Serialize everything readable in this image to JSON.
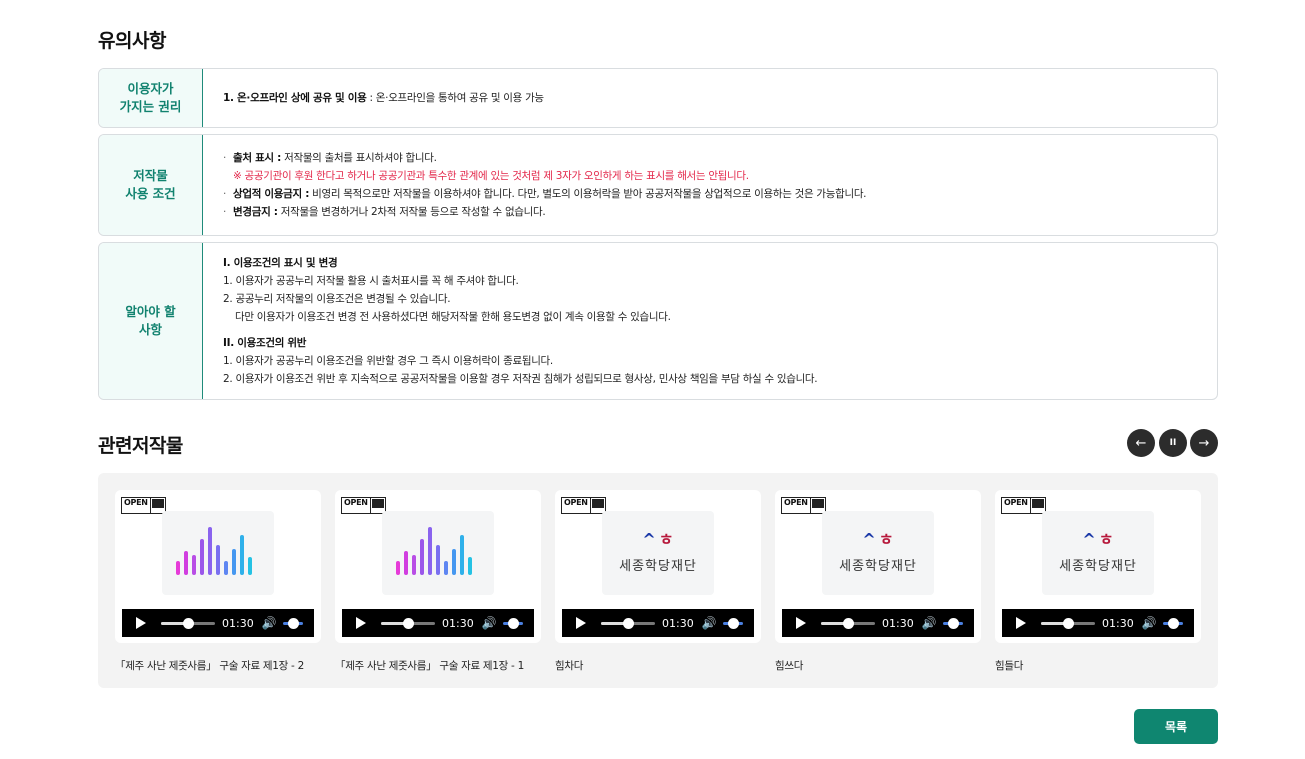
{
  "notice": {
    "title": "유의사항",
    "rights": {
      "label_1": "이용자가",
      "label_2": "가지는 권리",
      "text_bold": "1. 온·오프라인 상에 공유 및 이용",
      "text": " : 온·오프라인을 통하여 공유 및 이용 가능"
    },
    "conditions": {
      "label_1": "저작물",
      "label_2": "사용 조건",
      "items": [
        {
          "bold": "출처 표시 :",
          "text": " 저작물의 출처를 표시하셔야 합니다."
        },
        {
          "bold": "상업적 이용금지 :",
          "text": " 비영리 목적으로만 저작물을 이용하셔야 합니다. 다만, 별도의 이용허락을 받아 공공저작물을 상업적으로 이용하는 것은 가능합니다."
        },
        {
          "bold": "변경금지 :",
          "text": " 저작물을 변경하거나 2차적 저작물 등으로 작성할 수 없습니다."
        }
      ],
      "warning": "※ 공공기관이 후원 한다고 하거나 공공기관과 특수한 관계에 있는 것처럼 제 3자가 오인하게 하는 표시를 해서는 안됩니다."
    },
    "know": {
      "label_1": "알아야 할",
      "label_2": "사항",
      "section1_title": "I. 이용조건의 표시 및 변경",
      "section1_items": [
        "1. 이용자가 공공누리 저작물 활용 시 출처표시를 꼭 해 주셔야 합니다.",
        "2. 공공누리 저작물의 이용조건은 변경될 수 있습니다.",
        "다만 이용자가 이용조건 변경 전 사용하셨다면 해당저작물 한해 용도변경 없이 계속 이용할 수 있습니다."
      ],
      "section2_title": "II. 이용조건의 위반",
      "section2_items": [
        "1. 이용자가 공공누리 이용조건을 위반할 경우 그 즉시 이용허락이 종료됩니다.",
        "2. 이용자가 이용조건 위반 후 지속적으로 공공저작물을 이용할 경우 저작권 침해가 성립되므로 형사상, 민사상 책임을 부담 하실 수 있습니다."
      ]
    }
  },
  "related": {
    "title": "관련저작물",
    "controls": {
      "prev": "←",
      "pause": "II",
      "next": "→"
    },
    "items": [
      {
        "badge": "OPEN",
        "thumb": "equalizer",
        "time": "01:30",
        "progress": 0.5,
        "caption": "「제주 사난 제줏사름」 구술 자료 제1장 - 2"
      },
      {
        "badge": "OPEN",
        "thumb": "equalizer",
        "time": "01:30",
        "progress": 0.5,
        "caption": "「제주 사난 제줏사름」 구술 자료 제1장 - 1"
      },
      {
        "badge": "OPEN",
        "thumb": "logo",
        "logo_text": "세종학당재단",
        "time": "01:30",
        "progress": 0.5,
        "caption": "힘차다"
      },
      {
        "badge": "OPEN",
        "thumb": "logo",
        "logo_text": "세종학당재단",
        "time": "01:30",
        "progress": 0.5,
        "caption": "힘쓰다"
      },
      {
        "badge": "OPEN",
        "thumb": "logo",
        "logo_text": "세종학당재단",
        "time": "01:30",
        "progress": 0.5,
        "caption": "힘들다"
      }
    ]
  },
  "list_button": "목록",
  "colors": {
    "accent": "#0f8670",
    "label_bg": "#f1fbf9",
    "warning": "#e3284b"
  }
}
